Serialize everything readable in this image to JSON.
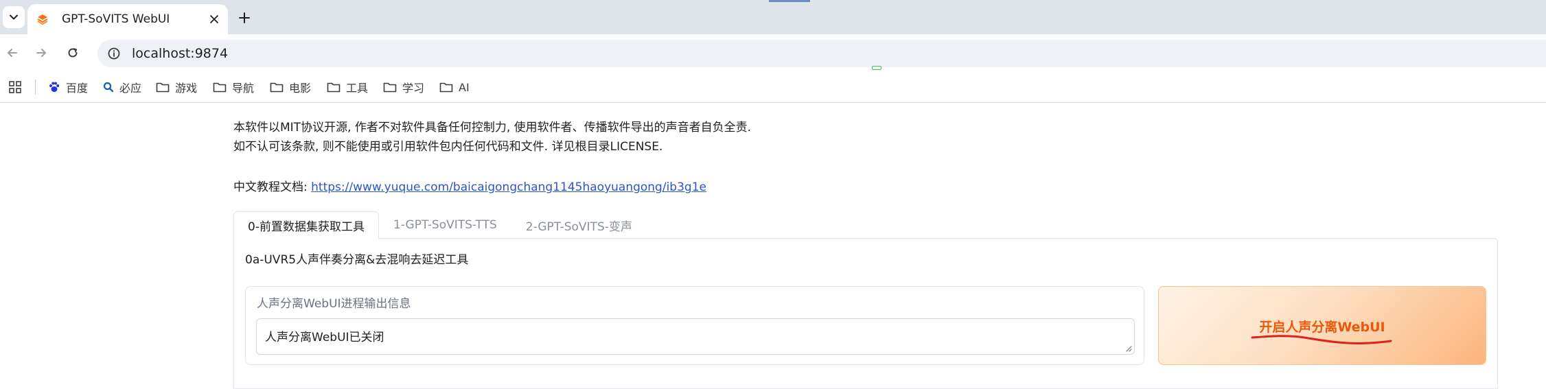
{
  "browser": {
    "tab_title": "GPT-SoVITS WebUI",
    "tab_icons": {
      "dropdown": "chevron-down-icon",
      "favicon": "gradio-logo-icon",
      "close": "close-icon",
      "new_tab": "plus-icon"
    },
    "url": "localhost:9874",
    "toolbar_icons": [
      "back-arrow-icon",
      "forward-arrow-icon",
      "reload-icon",
      "site-info-icon"
    ],
    "bookmarks": [
      {
        "label": "百度",
        "icon": "baidu-paw-icon"
      },
      {
        "label": "必应",
        "icon": "bing-search-icon"
      },
      {
        "label": "游戏",
        "icon": "folder-icon"
      },
      {
        "label": "导航",
        "icon": "folder-icon"
      },
      {
        "label": "电影",
        "icon": "folder-icon"
      },
      {
        "label": "工具",
        "icon": "folder-icon"
      },
      {
        "label": "学习",
        "icon": "folder-icon"
      },
      {
        "label": "AI",
        "icon": "folder-icon"
      }
    ]
  },
  "page": {
    "notice_line1": "本软件以MIT协议开源, 作者不对软件具备任何控制力, 使用软件者、传播软件导出的声音者自负全责.",
    "notice_line2": "如不认可该条款, 则不能使用或引用软件包内任何代码和文件. 详见根目录LICENSE.",
    "doc_label": "中文教程文档: ",
    "doc_link": "https://www.yuque.com/baicaigongchang1145haoyuangong/ib3g1e",
    "tabs": [
      {
        "label": "0-前置数据集获取工具",
        "active": true
      },
      {
        "label": "1-GPT-SoVITS-TTS",
        "active": false
      },
      {
        "label": "2-GPT-SoVITS-变声",
        "active": false
      }
    ],
    "section_title": "0a-UVR5人声伴奏分离&去混响去延迟工具",
    "output_label": "人声分离WebUI进程输出信息",
    "output_value": "人声分离WebUI已关闭",
    "button_label": "开启人声分离WebUI"
  },
  "colors": {
    "accent_orange": "#ea580c",
    "link_blue": "#2b56c6",
    "annotation_red": "#e0201b"
  }
}
